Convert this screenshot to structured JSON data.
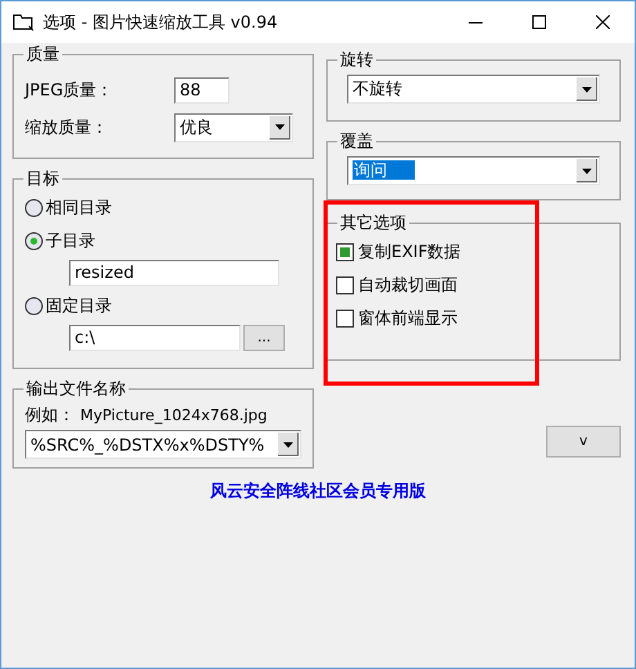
{
  "window": {
    "title": "选项 - 图片快速缩放工具 v0.94"
  },
  "quality": {
    "title": "质量",
    "jpeg_label": "JPEG质量：",
    "jpeg_value": "88",
    "scale_label": "缩放质量：",
    "scale_value": "优良"
  },
  "target": {
    "title": "目标",
    "options": [
      {
        "label": "相同目录",
        "selected": false
      },
      {
        "label": "子目录",
        "selected": true,
        "field": "resized"
      },
      {
        "label": "固定目录",
        "selected": false,
        "field": "c:\\",
        "browse": "..."
      }
    ]
  },
  "output": {
    "title": "输出文件名称",
    "example_label": "例如：",
    "example": "MyPicture_1024x768.jpg",
    "pattern": "%SRC%_%DSTX%x%DSTY%"
  },
  "rotate": {
    "title": "旋转",
    "value": "不旋转"
  },
  "overwrite": {
    "title": "覆盖",
    "value": "询问",
    "value_selected": true
  },
  "other": {
    "title": "其它选项",
    "highlighted": true,
    "options": [
      {
        "label": "复制EXIF数据",
        "checked": true
      },
      {
        "label": "自动裁切画面",
        "checked": false
      },
      {
        "label": "窗体前端显示",
        "checked": false
      }
    ]
  },
  "collapse_button": "v",
  "footer": "风云安全阵线社区会员专用版"
}
